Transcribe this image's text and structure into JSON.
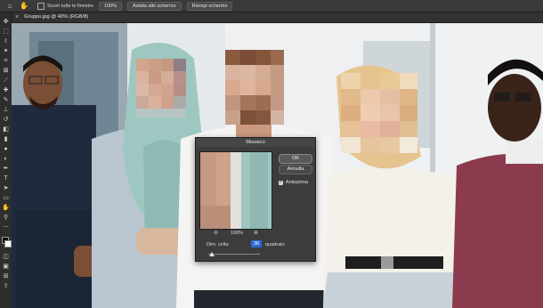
{
  "options_bar": {
    "checkbox_label": "Scorri tutte le finestre",
    "buttons": [
      "100%",
      "Adatta allo schermo",
      "Riempi schermo"
    ]
  },
  "document": {
    "tab_title": "Gruppo.jpg @ 40% (RGB/8)"
  },
  "toolbar": {
    "tools": [
      "move-icon",
      "marquee-icon",
      "lasso-icon",
      "magic-wand-icon",
      "crop-icon",
      "frame-icon",
      "eyedropper-icon",
      "healing-brush-icon",
      "brush-icon",
      "clone-stamp-icon",
      "history-brush-icon",
      "eraser-icon",
      "gradient-icon",
      "blur-icon",
      "dodge-icon",
      "pen-icon",
      "type-icon",
      "path-select-icon",
      "rectangle-icon",
      "hand-icon",
      "zoom-icon",
      "more-tools-icon",
      "color-swatches-icon",
      "quick-mask-icon",
      "screen-mode-icon",
      "artboard-icon",
      "share-icon"
    ]
  },
  "dialog": {
    "title": "Mosaico",
    "ok_label": "OK",
    "cancel_label": "Annulla",
    "preview_label": "Anteprima",
    "preview_checked": true,
    "zoom_value": "100%",
    "cell_label": "Dim. cella:",
    "cell_value": "38",
    "cell_unit": "quadrato"
  },
  "colors": {
    "options_bar_bg": "#3a3a3a",
    "dialog_bg": "#3c3c3c",
    "input_highlight": "#2d6bd6"
  }
}
